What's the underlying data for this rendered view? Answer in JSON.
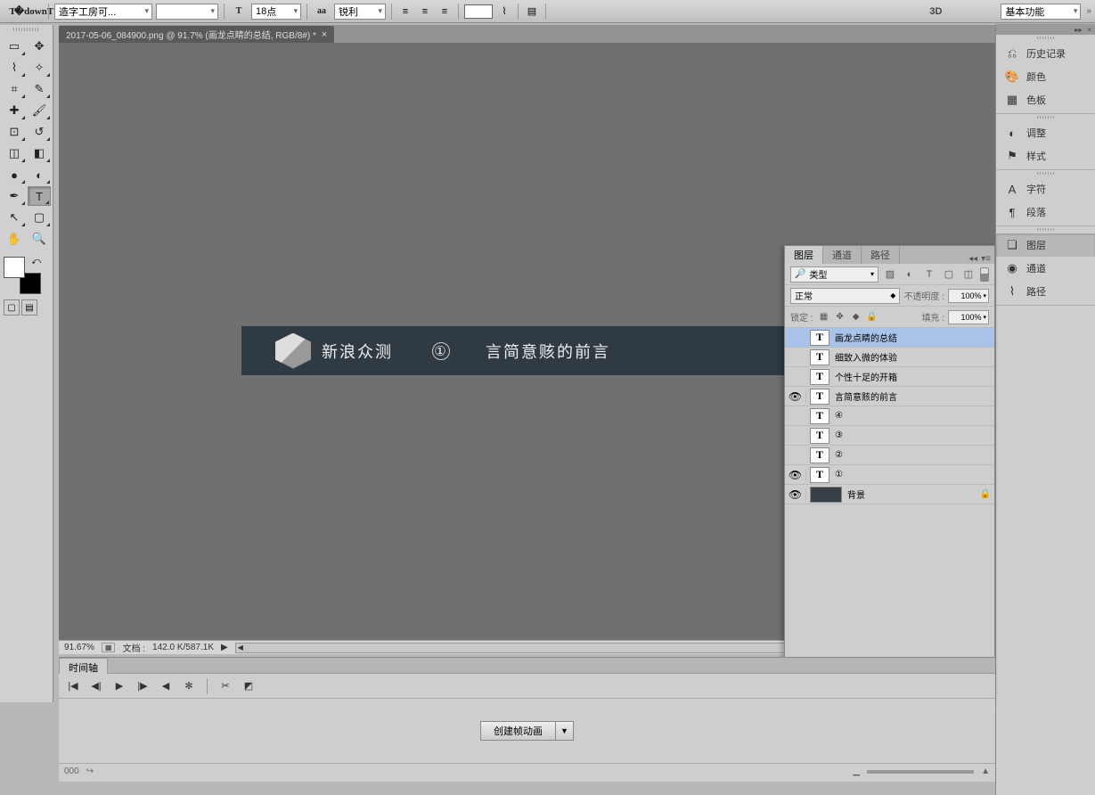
{
  "toolbar": {
    "font_family": "造字工房可...",
    "font_style": "",
    "font_size_value": "18",
    "font_size_unit": "点",
    "aa_label": "aa",
    "aa_mode": "锐利",
    "threeD": "3D",
    "workspace": "基本功能"
  },
  "tab": {
    "title": "2017-05-06_084900.png @ 91.7% (画龙点睛的总结, RGB/8#) *"
  },
  "canvas": {
    "brand": "新浪众测",
    "num": "①",
    "title": "言简意赅的前言"
  },
  "status": {
    "zoom": "91.67%",
    "doc_label": "文档 :",
    "doc_size": "142.0 K/587.1K"
  },
  "right_dock": {
    "groups": [
      {
        "items": [
          {
            "icon": "⎌",
            "label": "历史记录"
          },
          {
            "icon": "🎨",
            "label": "颜色"
          },
          {
            "icon": "▦",
            "label": "色板"
          }
        ]
      },
      {
        "items": [
          {
            "icon": "◐",
            "label": "调整"
          },
          {
            "icon": "⚑",
            "label": "样式"
          }
        ]
      },
      {
        "items": [
          {
            "icon": "A",
            "label": "字符"
          },
          {
            "icon": "¶",
            "label": "段落"
          }
        ]
      },
      {
        "items": [
          {
            "icon": "❏",
            "label": "图层",
            "active": true
          },
          {
            "icon": "◉",
            "label": "通道"
          },
          {
            "icon": "⌇",
            "label": "路径"
          }
        ]
      }
    ]
  },
  "layers_panel": {
    "tabs": [
      "图层",
      "通道",
      "路径"
    ],
    "filter_label": "类型",
    "blend_mode": "正常",
    "opacity_label": "不透明度 :",
    "opacity": "100%",
    "lock_label": "锁定 :",
    "fill_label": "填充 :",
    "fill": "100%",
    "layers": [
      {
        "vis": false,
        "thumb": "T",
        "name": "画龙点睛的总结",
        "sel": true
      },
      {
        "vis": false,
        "thumb": "T",
        "name": "细致入微的体验"
      },
      {
        "vis": false,
        "thumb": "T",
        "name": "个性十足的开箱"
      },
      {
        "vis": true,
        "thumb": "T",
        "name": "言简意赅的前言"
      },
      {
        "vis": false,
        "thumb": "T",
        "name": "④"
      },
      {
        "vis": false,
        "thumb": "T",
        "name": "③"
      },
      {
        "vis": false,
        "thumb": "T",
        "name": "②"
      },
      {
        "vis": true,
        "thumb": "T",
        "name": "①"
      },
      {
        "vis": true,
        "thumb": "bg",
        "name": "背景",
        "locked": true
      }
    ]
  },
  "timeline": {
    "tab": "时间轴",
    "create_btn": "创建帧动画"
  }
}
